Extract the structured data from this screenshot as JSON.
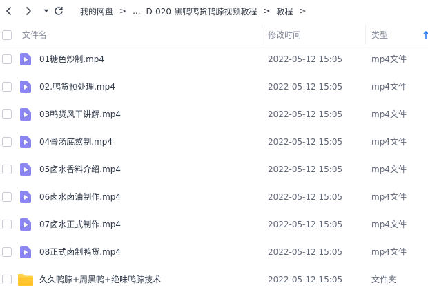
{
  "breadcrumb": {
    "root": "我的网盘",
    "ellipsis": "...",
    "parent": "D-020-黑鸭鸭货鸭脖视频教程",
    "current": "教程",
    "separator": ">"
  },
  "columns": {
    "name": "文件名",
    "modified": "修改时间",
    "type": "类型"
  },
  "colors": {
    "video_icon": "#8a85f0",
    "folder_icon": "#ffd04a",
    "sort_accent": "#2b7df7"
  },
  "files": [
    {
      "name": "01糖色炒制.mp4",
      "modified": "2022-05-12 15:05",
      "type": "mp4文件",
      "icon": "video-file-icon"
    },
    {
      "name": "02.鸭货预处理.mp4",
      "modified": "2022-05-12 15:05",
      "type": "mp4文件",
      "icon": "video-file-icon"
    },
    {
      "name": "03鸭货风干讲解.mp4",
      "modified": "2022-05-12 15:05",
      "type": "mp4文件",
      "icon": "video-file-icon"
    },
    {
      "name": "04骨汤底熬制.mp4",
      "modified": "2022-05-12 15:05",
      "type": "mp4文件",
      "icon": "video-file-icon"
    },
    {
      "name": "05卤水香料介绍.mp4",
      "modified": "2022-05-12 15:05",
      "type": "mp4文件",
      "icon": "video-file-icon"
    },
    {
      "name": "06卤水卤油制作.mp4",
      "modified": "2022-05-12 15:05",
      "type": "mp4文件",
      "icon": "video-file-icon"
    },
    {
      "name": "07卤水正式制作.mp4",
      "modified": "2022-05-12 15:05",
      "type": "mp4文件",
      "icon": "video-file-icon"
    },
    {
      "name": "08正式卤制鸭货.mp4",
      "modified": "2022-05-12 15:05",
      "type": "mp4文件",
      "icon": "video-file-icon"
    },
    {
      "name": "久久鸭脖+周黑鸭+绝味鸭脖技术",
      "modified": "2022-05-12 15:05",
      "type": "文件夹",
      "icon": "folder-icon"
    }
  ]
}
